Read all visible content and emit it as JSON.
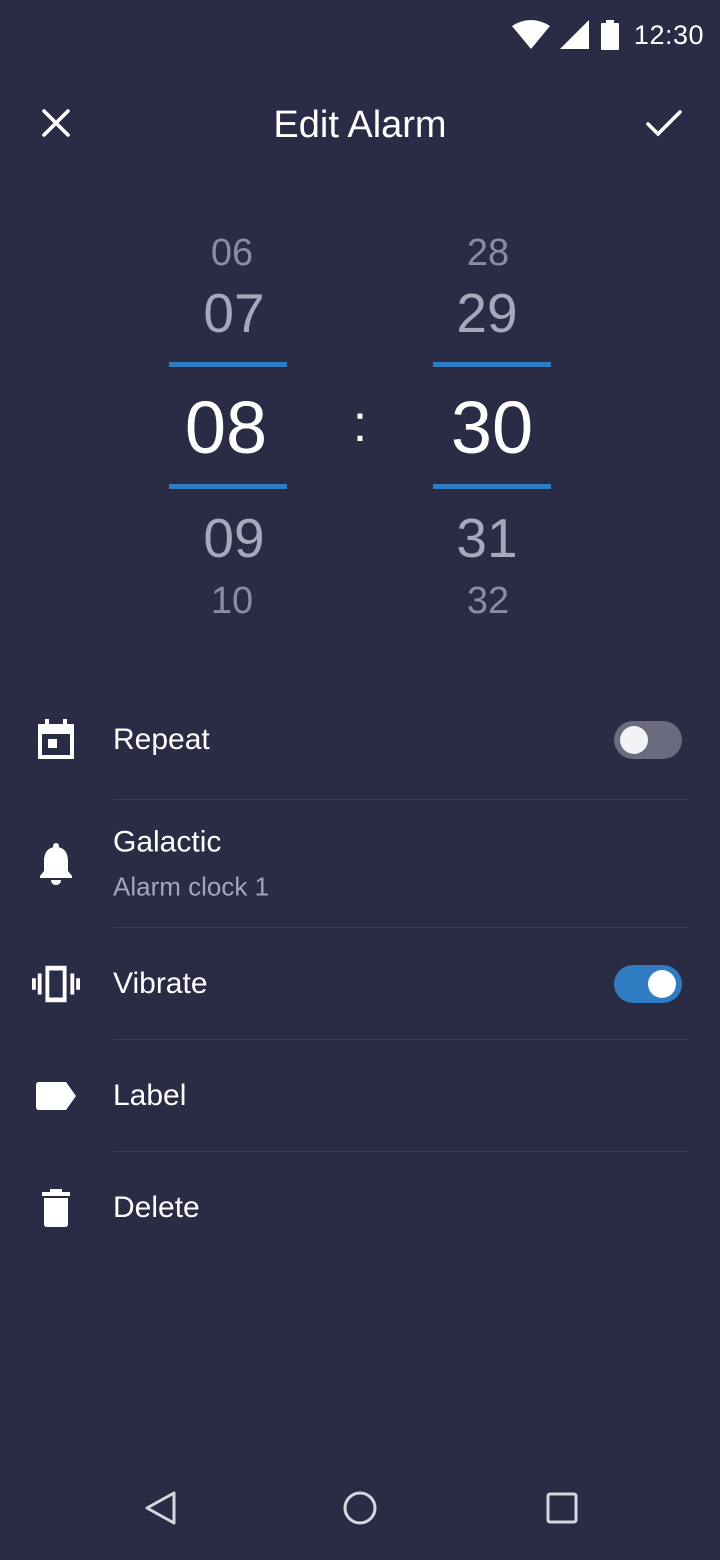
{
  "status_bar": {
    "time": "12:30",
    "icons": [
      "wifi-icon",
      "cellular-signal-icon",
      "battery-icon"
    ]
  },
  "app_bar": {
    "title": "Edit Alarm",
    "close_icon": "close-icon",
    "confirm_icon": "check-icon"
  },
  "time_picker": {
    "hours": {
      "above2": "06",
      "above1": "07",
      "selected": "08",
      "below1": "09",
      "below2": "10"
    },
    "separator": ":",
    "minutes": {
      "above2": "28",
      "above1": "29",
      "selected": "30",
      "below1": "31",
      "below2": "32"
    }
  },
  "settings": {
    "repeat": {
      "label": "Repeat",
      "icon": "calendar-icon",
      "enabled": false
    },
    "sound": {
      "label": "Galactic",
      "sublabel": "Alarm clock 1",
      "icon": "bell-icon"
    },
    "vibrate": {
      "label": "Vibrate",
      "icon": "vibrate-icon",
      "enabled": true
    },
    "label": {
      "label": "Label",
      "icon": "label-tag-icon"
    },
    "delete": {
      "label": "Delete",
      "icon": "trash-icon"
    }
  },
  "nav_bar": {
    "buttons": [
      "back-icon",
      "home-icon",
      "recents-icon"
    ]
  },
  "colors": {
    "background": "#2a2b45",
    "accent": "#2f7cc3",
    "toggle_off": "#6a6b7e",
    "secondary_text": "#a3a5ba"
  }
}
